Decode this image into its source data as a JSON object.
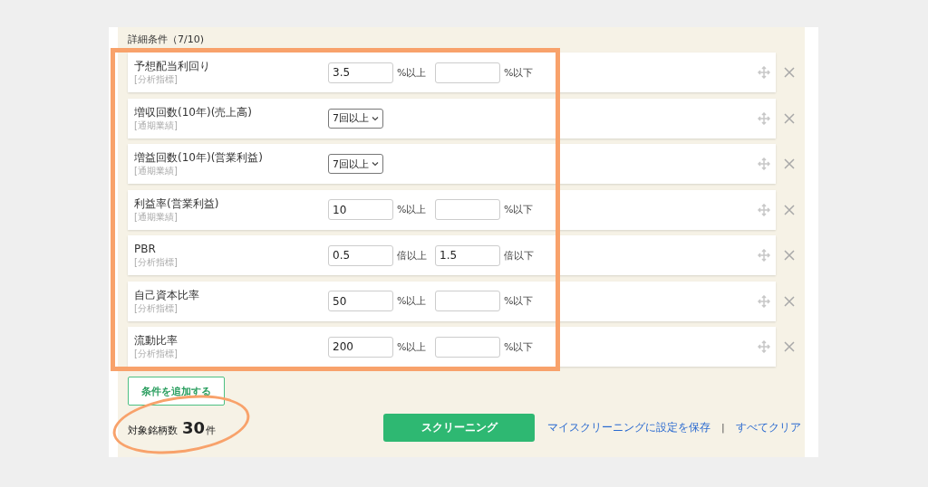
{
  "section_title": "詳細条件（7/10)",
  "conditions": [
    {
      "kind": "range",
      "label": "予想配当利回り",
      "category": "[分析指標]",
      "min": "3.5",
      "min_unit": "%以上",
      "max_unit": "%以下"
    },
    {
      "kind": "select",
      "label": "増収回数(10年)(売上高)",
      "category": "[通期業績]",
      "value": "7回以上"
    },
    {
      "kind": "select",
      "label": "増益回数(10年)(営業利益)",
      "category": "[通期業績]",
      "value": "7回以上"
    },
    {
      "kind": "range",
      "label": "利益率(営業利益)",
      "category": "[通期業績]",
      "min": "10",
      "min_unit": "%以上",
      "max_unit": "%以下"
    },
    {
      "kind": "range",
      "label": "PBR",
      "category": "[分析指標]",
      "min": "0.5",
      "min_unit": "倍以上",
      "max": "1.5",
      "max_unit": "倍以下"
    },
    {
      "kind": "range",
      "label": "自己資本比率",
      "category": "[分析指標]",
      "min": "50",
      "min_unit": "%以上",
      "max_unit": "%以下"
    },
    {
      "kind": "range",
      "label": "流動比率",
      "category": "[分析指標]",
      "min": "200",
      "min_unit": "%以上",
      "max_unit": "%以下"
    }
  ],
  "add_button": "条件を追加する",
  "count": {
    "label": "対象銘柄数",
    "value": "30",
    "unit": "件"
  },
  "screen_button": "スクリーニング",
  "links": [
    "マイスクリーニングに設定を保存",
    "すべてクリア"
  ],
  "link_separator": "|"
}
